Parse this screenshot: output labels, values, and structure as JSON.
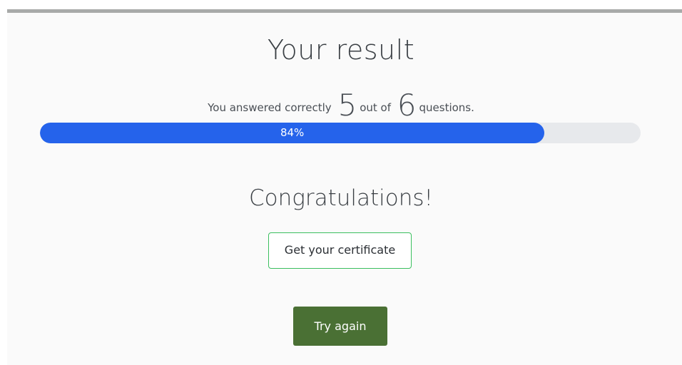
{
  "result": {
    "title": "Your result",
    "summary_prefix": "You answered correctly",
    "correct": "5",
    "summary_middle": "out of",
    "total": "6",
    "summary_suffix": "questions."
  },
  "progress": {
    "value": 84,
    "label": "84%",
    "fill_color": "#2563eb",
    "track_color": "#e7e9ec"
  },
  "message": {
    "congratulations": "Congratulations!"
  },
  "actions": {
    "certificate_label": "Get your certificate",
    "certificate_border_color": "#3bbf5f",
    "retry_label": "Try again",
    "retry_color": "#4a7034"
  }
}
